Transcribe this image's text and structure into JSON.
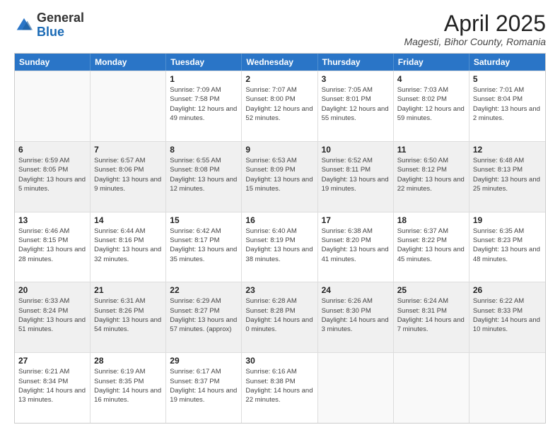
{
  "header": {
    "logo_general": "General",
    "logo_blue": "Blue",
    "month_title": "April 2025",
    "subtitle": "Magesti, Bihor County, Romania"
  },
  "days_of_week": [
    "Sunday",
    "Monday",
    "Tuesday",
    "Wednesday",
    "Thursday",
    "Friday",
    "Saturday"
  ],
  "weeks": [
    [
      {
        "day": "",
        "empty": true
      },
      {
        "day": "",
        "empty": true
      },
      {
        "day": "1",
        "sunrise": "Sunrise: 7:09 AM",
        "sunset": "Sunset: 7:58 PM",
        "daylight": "Daylight: 12 hours and 49 minutes."
      },
      {
        "day": "2",
        "sunrise": "Sunrise: 7:07 AM",
        "sunset": "Sunset: 8:00 PM",
        "daylight": "Daylight: 12 hours and 52 minutes."
      },
      {
        "day": "3",
        "sunrise": "Sunrise: 7:05 AM",
        "sunset": "Sunset: 8:01 PM",
        "daylight": "Daylight: 12 hours and 55 minutes."
      },
      {
        "day": "4",
        "sunrise": "Sunrise: 7:03 AM",
        "sunset": "Sunset: 8:02 PM",
        "daylight": "Daylight: 12 hours and 59 minutes."
      },
      {
        "day": "5",
        "sunrise": "Sunrise: 7:01 AM",
        "sunset": "Sunset: 8:04 PM",
        "daylight": "Daylight: 13 hours and 2 minutes."
      }
    ],
    [
      {
        "day": "6",
        "sunrise": "Sunrise: 6:59 AM",
        "sunset": "Sunset: 8:05 PM",
        "daylight": "Daylight: 13 hours and 5 minutes."
      },
      {
        "day": "7",
        "sunrise": "Sunrise: 6:57 AM",
        "sunset": "Sunset: 8:06 PM",
        "daylight": "Daylight: 13 hours and 9 minutes."
      },
      {
        "day": "8",
        "sunrise": "Sunrise: 6:55 AM",
        "sunset": "Sunset: 8:08 PM",
        "daylight": "Daylight: 13 hours and 12 minutes."
      },
      {
        "day": "9",
        "sunrise": "Sunrise: 6:53 AM",
        "sunset": "Sunset: 8:09 PM",
        "daylight": "Daylight: 13 hours and 15 minutes."
      },
      {
        "day": "10",
        "sunrise": "Sunrise: 6:52 AM",
        "sunset": "Sunset: 8:11 PM",
        "daylight": "Daylight: 13 hours and 19 minutes."
      },
      {
        "day": "11",
        "sunrise": "Sunrise: 6:50 AM",
        "sunset": "Sunset: 8:12 PM",
        "daylight": "Daylight: 13 hours and 22 minutes."
      },
      {
        "day": "12",
        "sunrise": "Sunrise: 6:48 AM",
        "sunset": "Sunset: 8:13 PM",
        "daylight": "Daylight: 13 hours and 25 minutes."
      }
    ],
    [
      {
        "day": "13",
        "sunrise": "Sunrise: 6:46 AM",
        "sunset": "Sunset: 8:15 PM",
        "daylight": "Daylight: 13 hours and 28 minutes."
      },
      {
        "day": "14",
        "sunrise": "Sunrise: 6:44 AM",
        "sunset": "Sunset: 8:16 PM",
        "daylight": "Daylight: 13 hours and 32 minutes."
      },
      {
        "day": "15",
        "sunrise": "Sunrise: 6:42 AM",
        "sunset": "Sunset: 8:17 PM",
        "daylight": "Daylight: 13 hours and 35 minutes."
      },
      {
        "day": "16",
        "sunrise": "Sunrise: 6:40 AM",
        "sunset": "Sunset: 8:19 PM",
        "daylight": "Daylight: 13 hours and 38 minutes."
      },
      {
        "day": "17",
        "sunrise": "Sunrise: 6:38 AM",
        "sunset": "Sunset: 8:20 PM",
        "daylight": "Daylight: 13 hours and 41 minutes."
      },
      {
        "day": "18",
        "sunrise": "Sunrise: 6:37 AM",
        "sunset": "Sunset: 8:22 PM",
        "daylight": "Daylight: 13 hours and 45 minutes."
      },
      {
        "day": "19",
        "sunrise": "Sunrise: 6:35 AM",
        "sunset": "Sunset: 8:23 PM",
        "daylight": "Daylight: 13 hours and 48 minutes."
      }
    ],
    [
      {
        "day": "20",
        "sunrise": "Sunrise: 6:33 AM",
        "sunset": "Sunset: 8:24 PM",
        "daylight": "Daylight: 13 hours and 51 minutes."
      },
      {
        "day": "21",
        "sunrise": "Sunrise: 6:31 AM",
        "sunset": "Sunset: 8:26 PM",
        "daylight": "Daylight: 13 hours and 54 minutes."
      },
      {
        "day": "22",
        "sunrise": "Sunrise: 6:29 AM",
        "sunset": "Sunset: 8:27 PM",
        "daylight": "Daylight: 13 hours and 57 minutes. (approx)"
      },
      {
        "day": "23",
        "sunrise": "Sunrise: 6:28 AM",
        "sunset": "Sunset: 8:28 PM",
        "daylight": "Daylight: 14 hours and 0 minutes."
      },
      {
        "day": "24",
        "sunrise": "Sunrise: 6:26 AM",
        "sunset": "Sunset: 8:30 PM",
        "daylight": "Daylight: 14 hours and 3 minutes."
      },
      {
        "day": "25",
        "sunrise": "Sunrise: 6:24 AM",
        "sunset": "Sunset: 8:31 PM",
        "daylight": "Daylight: 14 hours and 7 minutes."
      },
      {
        "day": "26",
        "sunrise": "Sunrise: 6:22 AM",
        "sunset": "Sunset: 8:33 PM",
        "daylight": "Daylight: 14 hours and 10 minutes."
      }
    ],
    [
      {
        "day": "27",
        "sunrise": "Sunrise: 6:21 AM",
        "sunset": "Sunset: 8:34 PM",
        "daylight": "Daylight: 14 hours and 13 minutes."
      },
      {
        "day": "28",
        "sunrise": "Sunrise: 6:19 AM",
        "sunset": "Sunset: 8:35 PM",
        "daylight": "Daylight: 14 hours and 16 minutes."
      },
      {
        "day": "29",
        "sunrise": "Sunrise: 6:17 AM",
        "sunset": "Sunset: 8:37 PM",
        "daylight": "Daylight: 14 hours and 19 minutes."
      },
      {
        "day": "30",
        "sunrise": "Sunrise: 6:16 AM",
        "sunset": "Sunset: 8:38 PM",
        "daylight": "Daylight: 14 hours and 22 minutes."
      },
      {
        "day": "",
        "empty": true
      },
      {
        "day": "",
        "empty": true
      },
      {
        "day": "",
        "empty": true
      }
    ]
  ]
}
